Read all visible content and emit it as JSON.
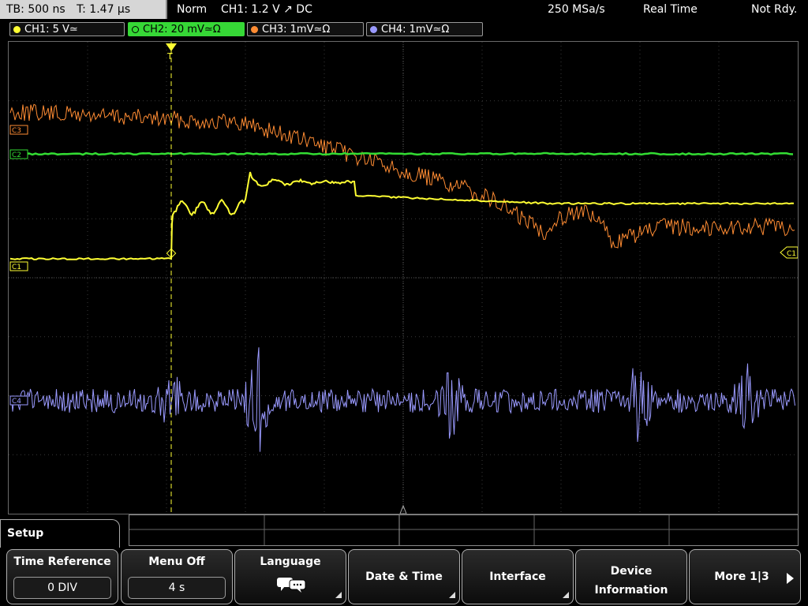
{
  "topbar": {
    "timebase": "TB: 500 ns",
    "trigger_time": "T: 1.47 µs",
    "mode": "Norm",
    "trigger_info": "CH1: 1.2 V ↗ DC",
    "sample_rate": "250 MSa/s",
    "acq_mode": "Real Time",
    "status": "Not Rdy."
  },
  "channels": [
    {
      "label": "CH1: 5 V≃",
      "color": "#ffff33",
      "active": false
    },
    {
      "label": "CH2: 20 mV≃Ω",
      "color": "#33dd33",
      "active": true
    },
    {
      "label": "CH3: 1mV≃Ω",
      "color": "#ff8c33",
      "active": false
    },
    {
      "label": "CH4: 1mV≃Ω",
      "color": "#9a9aff",
      "active": false
    }
  ],
  "markers": {
    "c3": "C3",
    "c2": "C2",
    "c1": "C1",
    "c4": "C4",
    "trigger_marker": "T",
    "right_marker": "C1"
  },
  "colors": {
    "ch1": "#ffff33",
    "ch2": "#33dd33",
    "ch3": "#ff8c33",
    "ch4": "#9a9aff",
    "grid": "#555555"
  },
  "menu": {
    "title": "Setup",
    "softkeys": [
      {
        "label": "Time Reference",
        "value": "0 DIV"
      },
      {
        "label": "Menu Off",
        "value": "4 s"
      },
      {
        "label": "Language",
        "icon": "speech-bubbles-icon"
      },
      {
        "label": "Date & Time"
      },
      {
        "label": "Interface"
      },
      {
        "label": "Device Information"
      },
      {
        "label": "More 1|3"
      }
    ]
  }
}
